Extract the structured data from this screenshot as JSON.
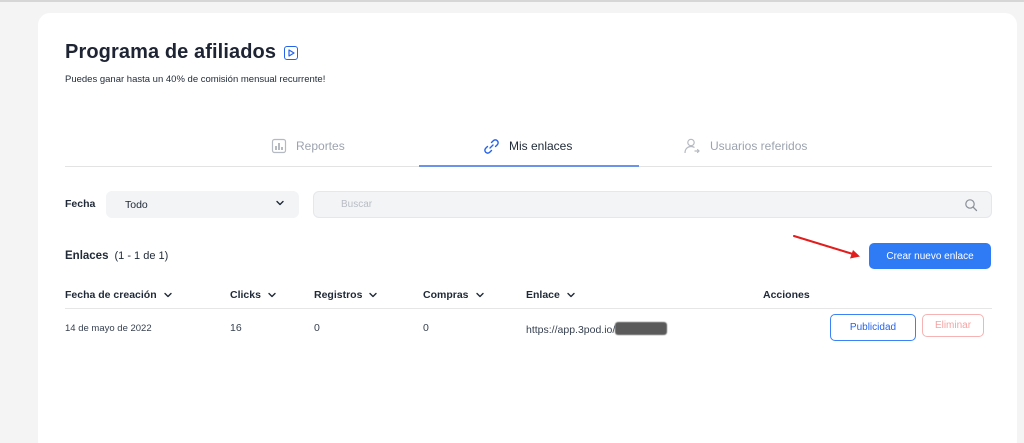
{
  "header": {
    "title": "Programa de afiliados",
    "subtitle": "Puedes ganar hasta un 40% de comisión mensual recurrente!"
  },
  "tabs": [
    {
      "label": "Reportes",
      "icon": "report-icon",
      "active": false
    },
    {
      "label": "Mis enlaces",
      "icon": "link-icon",
      "active": true
    },
    {
      "label": "Usuarios referidos",
      "icon": "user-share-icon",
      "active": false
    }
  ],
  "filters": {
    "fecha_label": "Fecha",
    "fecha_value": "Todo",
    "search_placeholder": "Buscar"
  },
  "links": {
    "title": "Enlaces",
    "count": "(1 - 1 de 1)",
    "create_button": "Crear nuevo enlace"
  },
  "table": {
    "columns": [
      "Fecha de creación",
      "Clicks",
      "Registros",
      "Compras",
      "Enlace",
      "Acciones"
    ],
    "rows": [
      {
        "fecha": "14 de mayo de 2022",
        "clicks": "16",
        "registros": "0",
        "compras": "0",
        "enlace": "https://app.3pod.io/",
        "actions": {
          "publicidad": "Publicidad",
          "eliminar": "Eliminar"
        }
      }
    ]
  },
  "colors": {
    "accent": "#2f7af5",
    "danger": "#f4a3a3",
    "annotation_arrow": "#e11d1d"
  }
}
